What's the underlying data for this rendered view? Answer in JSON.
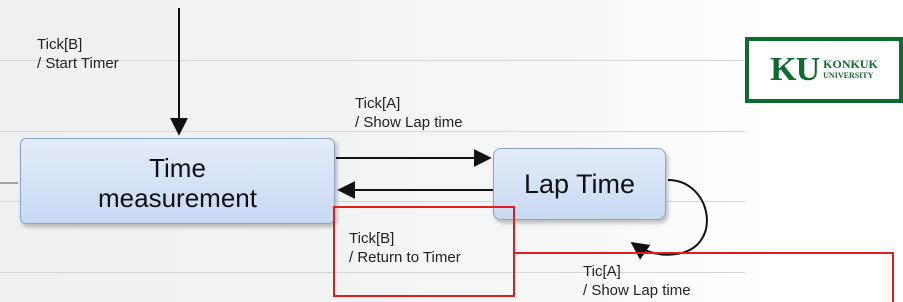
{
  "labels": {
    "tick_b_start": [
      "Tick[B]",
      "/ Start Timer"
    ],
    "tick_a_show": [
      "Tick[A]",
      "/ Show Lap time"
    ],
    "tick_b_return": [
      "Tick[B]",
      "/ Return  to Timer"
    ],
    "tic_a_show": [
      "Tic[A]",
      "/ Show Lap time"
    ]
  },
  "states": {
    "time_measurement": [
      "Time",
      "measurement"
    ],
    "lap_time": "Lap Time"
  },
  "logo": {
    "mark": "KU",
    "line1": "KONKUK",
    "line2": "UNIVERSITY",
    "color": "#0f6b2c"
  },
  "colors": {
    "state_fill": "#d5e2f7",
    "state_border": "#8aa3c8",
    "highlight": "#e01c1c",
    "arrow": "#111111"
  }
}
